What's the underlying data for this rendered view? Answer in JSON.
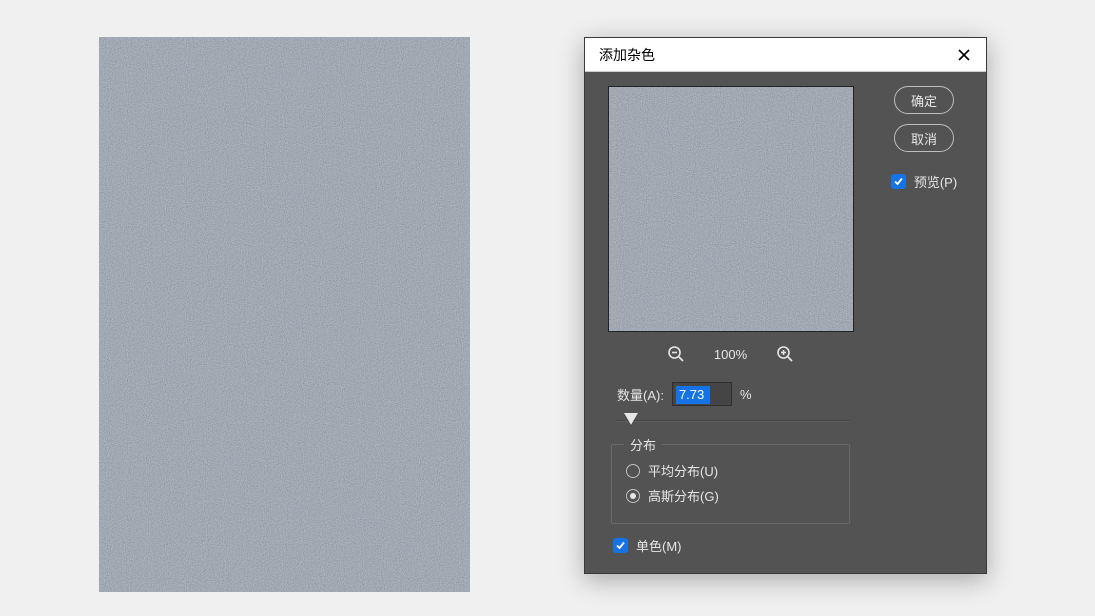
{
  "dialog": {
    "title": "添加杂色",
    "ok_label": "确定",
    "cancel_label": "取消",
    "preview_label": "预览(P)",
    "preview_checked": true,
    "zoom_level": "100%",
    "amount_label": "数量(A):",
    "amount_value": "7.73",
    "amount_unit": "%",
    "slider_position_pct": 6,
    "distribution": {
      "legend": "分布",
      "options": [
        {
          "label": "平均分布(U)",
          "checked": false
        },
        {
          "label": "高斯分布(G)",
          "checked": true
        }
      ]
    },
    "monochromatic_label": "单色(M)",
    "monochromatic_checked": true
  }
}
